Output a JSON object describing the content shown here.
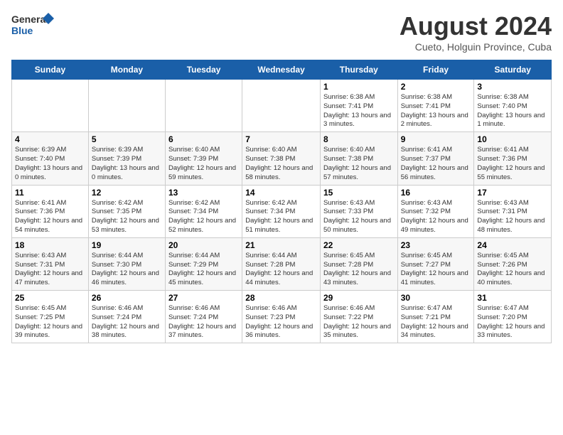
{
  "header": {
    "logo_line1": "General",
    "logo_line2": "Blue",
    "title": "August 2024",
    "subtitle": "Cueto, Holguin Province, Cuba"
  },
  "days_of_week": [
    "Sunday",
    "Monday",
    "Tuesday",
    "Wednesday",
    "Thursday",
    "Friday",
    "Saturday"
  ],
  "weeks": [
    [
      {
        "day": "",
        "empty": true
      },
      {
        "day": "",
        "empty": true
      },
      {
        "day": "",
        "empty": true
      },
      {
        "day": "",
        "empty": true
      },
      {
        "day": "1",
        "sunrise": "Sunrise: 6:38 AM",
        "sunset": "Sunset: 7:41 PM",
        "daylight": "Daylight: 13 hours and 3 minutes."
      },
      {
        "day": "2",
        "sunrise": "Sunrise: 6:38 AM",
        "sunset": "Sunset: 7:41 PM",
        "daylight": "Daylight: 13 hours and 2 minutes."
      },
      {
        "day": "3",
        "sunrise": "Sunrise: 6:38 AM",
        "sunset": "Sunset: 7:40 PM",
        "daylight": "Daylight: 13 hours and 1 minute."
      }
    ],
    [
      {
        "day": "4",
        "sunrise": "Sunrise: 6:39 AM",
        "sunset": "Sunset: 7:40 PM",
        "daylight": "Daylight: 13 hours and 0 minutes."
      },
      {
        "day": "5",
        "sunrise": "Sunrise: 6:39 AM",
        "sunset": "Sunset: 7:39 PM",
        "daylight": "Daylight: 13 hours and 0 minutes."
      },
      {
        "day": "6",
        "sunrise": "Sunrise: 6:40 AM",
        "sunset": "Sunset: 7:39 PM",
        "daylight": "Daylight: 12 hours and 59 minutes."
      },
      {
        "day": "7",
        "sunrise": "Sunrise: 6:40 AM",
        "sunset": "Sunset: 7:38 PM",
        "daylight": "Daylight: 12 hours and 58 minutes."
      },
      {
        "day": "8",
        "sunrise": "Sunrise: 6:40 AM",
        "sunset": "Sunset: 7:38 PM",
        "daylight": "Daylight: 12 hours and 57 minutes."
      },
      {
        "day": "9",
        "sunrise": "Sunrise: 6:41 AM",
        "sunset": "Sunset: 7:37 PM",
        "daylight": "Daylight: 12 hours and 56 minutes."
      },
      {
        "day": "10",
        "sunrise": "Sunrise: 6:41 AM",
        "sunset": "Sunset: 7:36 PM",
        "daylight": "Daylight: 12 hours and 55 minutes."
      }
    ],
    [
      {
        "day": "11",
        "sunrise": "Sunrise: 6:41 AM",
        "sunset": "Sunset: 7:36 PM",
        "daylight": "Daylight: 12 hours and 54 minutes."
      },
      {
        "day": "12",
        "sunrise": "Sunrise: 6:42 AM",
        "sunset": "Sunset: 7:35 PM",
        "daylight": "Daylight: 12 hours and 53 minutes."
      },
      {
        "day": "13",
        "sunrise": "Sunrise: 6:42 AM",
        "sunset": "Sunset: 7:34 PM",
        "daylight": "Daylight: 12 hours and 52 minutes."
      },
      {
        "day": "14",
        "sunrise": "Sunrise: 6:42 AM",
        "sunset": "Sunset: 7:34 PM",
        "daylight": "Daylight: 12 hours and 51 minutes."
      },
      {
        "day": "15",
        "sunrise": "Sunrise: 6:43 AM",
        "sunset": "Sunset: 7:33 PM",
        "daylight": "Daylight: 12 hours and 50 minutes."
      },
      {
        "day": "16",
        "sunrise": "Sunrise: 6:43 AM",
        "sunset": "Sunset: 7:32 PM",
        "daylight": "Daylight: 12 hours and 49 minutes."
      },
      {
        "day": "17",
        "sunrise": "Sunrise: 6:43 AM",
        "sunset": "Sunset: 7:31 PM",
        "daylight": "Daylight: 12 hours and 48 minutes."
      }
    ],
    [
      {
        "day": "18",
        "sunrise": "Sunrise: 6:43 AM",
        "sunset": "Sunset: 7:31 PM",
        "daylight": "Daylight: 12 hours and 47 minutes."
      },
      {
        "day": "19",
        "sunrise": "Sunrise: 6:44 AM",
        "sunset": "Sunset: 7:30 PM",
        "daylight": "Daylight: 12 hours and 46 minutes."
      },
      {
        "day": "20",
        "sunrise": "Sunrise: 6:44 AM",
        "sunset": "Sunset: 7:29 PM",
        "daylight": "Daylight: 12 hours and 45 minutes."
      },
      {
        "day": "21",
        "sunrise": "Sunrise: 6:44 AM",
        "sunset": "Sunset: 7:28 PM",
        "daylight": "Daylight: 12 hours and 44 minutes."
      },
      {
        "day": "22",
        "sunrise": "Sunrise: 6:45 AM",
        "sunset": "Sunset: 7:28 PM",
        "daylight": "Daylight: 12 hours and 43 minutes."
      },
      {
        "day": "23",
        "sunrise": "Sunrise: 6:45 AM",
        "sunset": "Sunset: 7:27 PM",
        "daylight": "Daylight: 12 hours and 41 minutes."
      },
      {
        "day": "24",
        "sunrise": "Sunrise: 6:45 AM",
        "sunset": "Sunset: 7:26 PM",
        "daylight": "Daylight: 12 hours and 40 minutes."
      }
    ],
    [
      {
        "day": "25",
        "sunrise": "Sunrise: 6:45 AM",
        "sunset": "Sunset: 7:25 PM",
        "daylight": "Daylight: 12 hours and 39 minutes."
      },
      {
        "day": "26",
        "sunrise": "Sunrise: 6:46 AM",
        "sunset": "Sunset: 7:24 PM",
        "daylight": "Daylight: 12 hours and 38 minutes."
      },
      {
        "day": "27",
        "sunrise": "Sunrise: 6:46 AM",
        "sunset": "Sunset: 7:24 PM",
        "daylight": "Daylight: 12 hours and 37 minutes."
      },
      {
        "day": "28",
        "sunrise": "Sunrise: 6:46 AM",
        "sunset": "Sunset: 7:23 PM",
        "daylight": "Daylight: 12 hours and 36 minutes."
      },
      {
        "day": "29",
        "sunrise": "Sunrise: 6:46 AM",
        "sunset": "Sunset: 7:22 PM",
        "daylight": "Daylight: 12 hours and 35 minutes."
      },
      {
        "day": "30",
        "sunrise": "Sunrise: 6:47 AM",
        "sunset": "Sunset: 7:21 PM",
        "daylight": "Daylight: 12 hours and 34 minutes."
      },
      {
        "day": "31",
        "sunrise": "Sunrise: 6:47 AM",
        "sunset": "Sunset: 7:20 PM",
        "daylight": "Daylight: 12 hours and 33 minutes."
      }
    ]
  ]
}
